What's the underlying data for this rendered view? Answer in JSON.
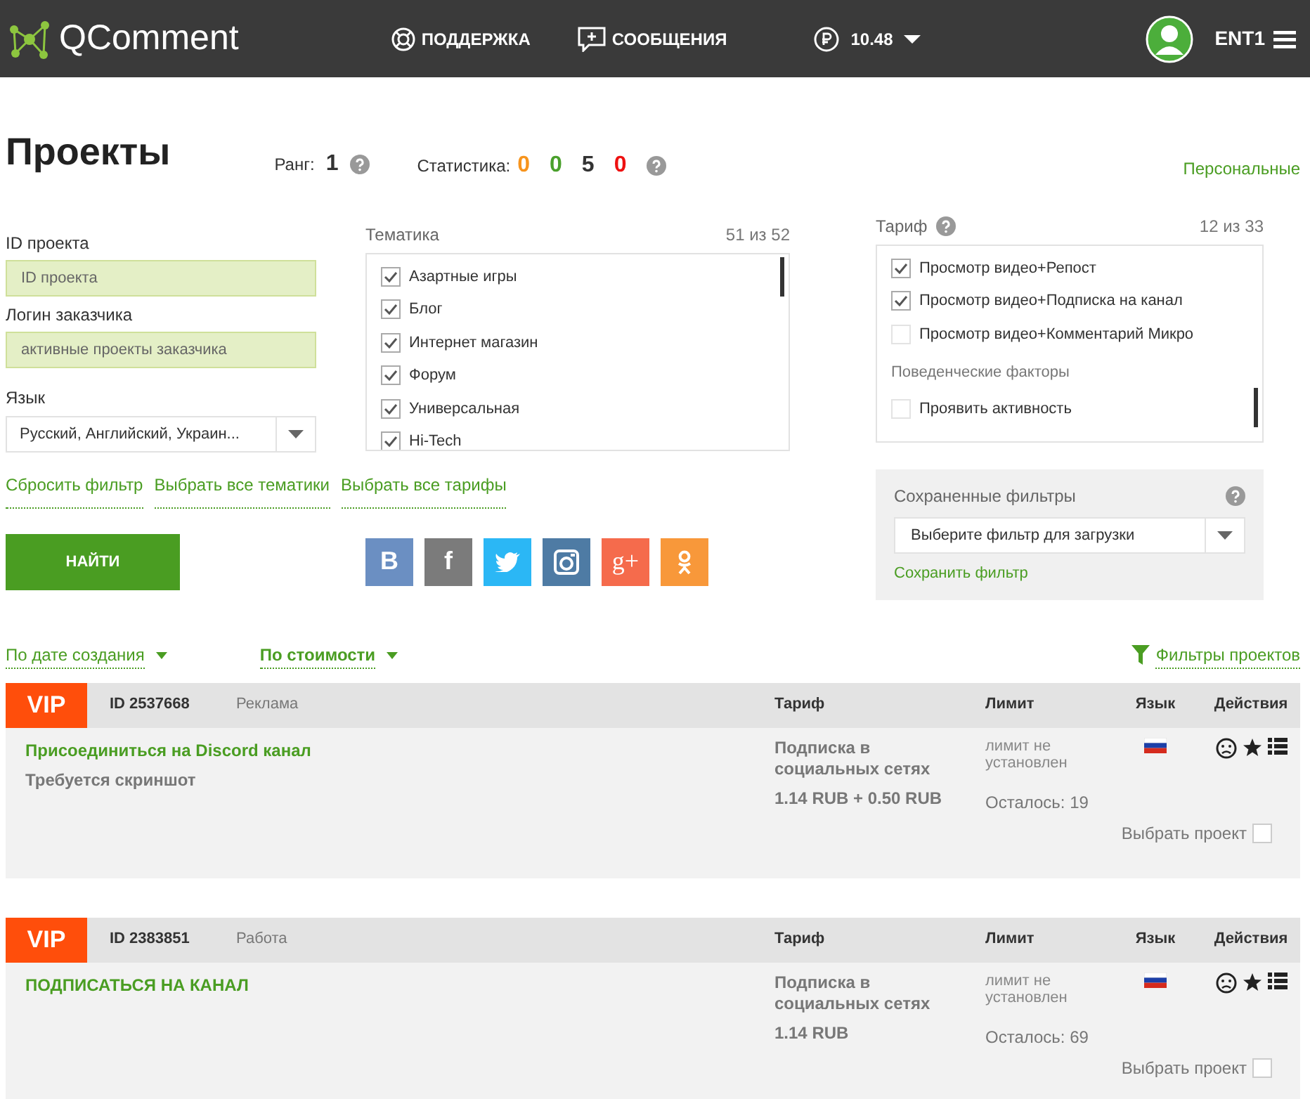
{
  "header": {
    "logo_text": "QComment",
    "nav": [
      {
        "kind": "support",
        "label": "ПОДДЕРЖКА"
      },
      {
        "kind": "messages",
        "label": "СООБЩЕНИЯ"
      }
    ],
    "balance": "10.48",
    "user": "ENT1"
  },
  "page": {
    "title": "Проекты",
    "rank_label": "Ранг:",
    "rank": "1",
    "stats_label": "Статистика:",
    "stats": [
      {
        "value": "0",
        "color": "#f7941d"
      },
      {
        "value": "0",
        "color": "#4aa02c"
      },
      {
        "value": "5",
        "color": "#333333"
      },
      {
        "value": "0",
        "color": "#ee1111"
      }
    ],
    "personal_link": "Персональные"
  },
  "filters": {
    "project_id": {
      "label": "ID проекта",
      "placeholder": "ID проекта"
    },
    "customer_login": {
      "label": "Логин заказчика",
      "placeholder": "активные проекты заказчика"
    },
    "language": {
      "label": "Язык",
      "value": "Русский, Английский, Украин..."
    },
    "topics": {
      "label": "Тематика",
      "count": "51 из 52",
      "items": [
        {
          "label": "Азартные игры",
          "checked": true
        },
        {
          "label": "Блог",
          "checked": true
        },
        {
          "label": "Интернет магазин",
          "checked": true
        },
        {
          "label": "Форум",
          "checked": true
        },
        {
          "label": "Универсальная",
          "checked": true
        },
        {
          "label": "Hi-Tech",
          "checked": true
        }
      ]
    },
    "tariffs": {
      "label": "Тариф",
      "count": "12 из 33",
      "items": [
        {
          "kind": "option",
          "label": "Просмотр видео+Репост",
          "checked": true
        },
        {
          "kind": "option",
          "label": "Просмотр видео+Подписка на канал",
          "checked": true
        },
        {
          "kind": "option",
          "label": "Просмотр видео+Комментарий Микро",
          "checked": false
        },
        {
          "kind": "heading",
          "label": "Поведенческие факторы"
        },
        {
          "kind": "option",
          "label": "Проявить активность",
          "checked": false
        }
      ]
    },
    "links": [
      "Сбросить фильтр",
      "Выбрать все тематики",
      "Выбрать все тарифы"
    ],
    "find_button": "НАЙТИ",
    "social": [
      {
        "kind": "vk",
        "glyph": "B"
      },
      {
        "kind": "facebook",
        "glyph": "f"
      },
      {
        "kind": "twitter"
      },
      {
        "kind": "instagram"
      },
      {
        "kind": "googleplus",
        "glyph": "g+"
      },
      {
        "kind": "odnoklassniki"
      }
    ],
    "saved_filters": {
      "label": "Сохраненные фильтры",
      "placeholder": "Выберите фильтр для загрузки",
      "save_link": "Сохранить фильтр"
    }
  },
  "sort": [
    {
      "label": "По дате создания",
      "selected": false
    },
    {
      "label": "По стоимости",
      "selected": true
    }
  ],
  "filters_link": "Фильтры проектов",
  "projects": [
    {
      "badge": "VIP",
      "id": "ID 2537668",
      "category": "Реклама",
      "columns": [
        "Тариф",
        "Лимит",
        "Язык",
        "Действия"
      ],
      "title": "Присоединиться на Discord канал",
      "subtitle": "Требуется скриншот",
      "tariff": "Подписка в социальных сетях",
      "price": "1.14 RUB + 0.50 RUB",
      "limit": "лимит не установлен",
      "remaining": "Осталось: 19",
      "select_label": "Выбрать проект",
      "selected": false
    },
    {
      "badge": "VIP",
      "id": "ID 2383851",
      "category": "Работа",
      "columns": [
        "Тариф",
        "Лимит",
        "Язык",
        "Действия"
      ],
      "title": "ПОДПИСАТЬСЯ НА КАНАЛ",
      "tariff": "Подписка в социальных сетях",
      "price": "1.14 RUB",
      "limit": "лимит не установлен",
      "remaining": "Осталось: 69",
      "select_label": "Выбрать проект",
      "selected": false
    }
  ]
}
